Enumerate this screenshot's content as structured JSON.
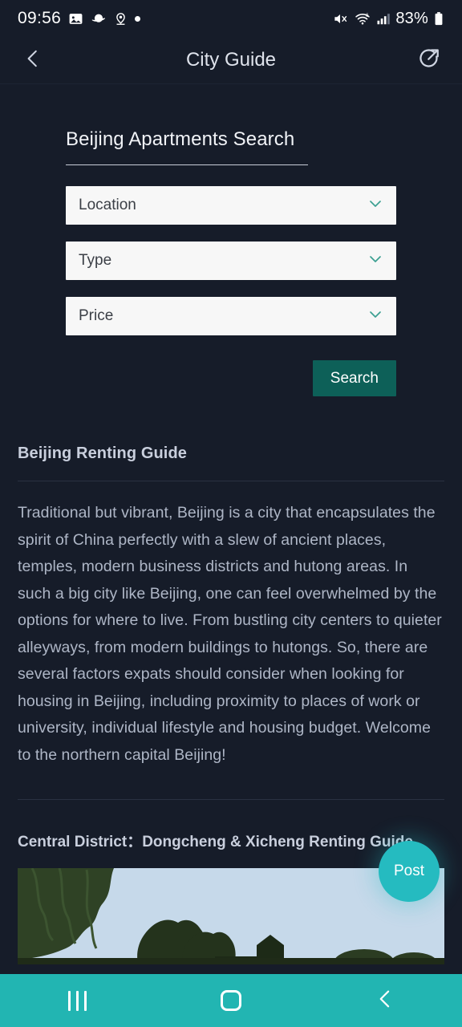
{
  "statusbar": {
    "time": "09:56",
    "battery_text": "83%",
    "left_icons": [
      "image-icon",
      "planet-icon",
      "location-pin-icon",
      "dot-icon"
    ],
    "right_icons": [
      "mute-icon",
      "wifi-6-icon",
      "cellular-signal-icon",
      "battery-icon"
    ]
  },
  "header": {
    "title": "City Guide",
    "back_icon": "chevron-left-icon",
    "share_icon": "share-icon"
  },
  "search_card": {
    "title": "Beijing Apartments Search",
    "fields": [
      {
        "label": "Location",
        "name": "location"
      },
      {
        "label": "Type",
        "name": "type"
      },
      {
        "label": "Price",
        "name": "price"
      }
    ],
    "submit_label": "Search",
    "chevron_icon": "chevron-down-icon"
  },
  "guide": {
    "heading": "Beijing Renting Guide",
    "body": "Traditional but vibrant, Beijing is a city that encapsulates the spirit of China perfectly with a slew of ancient places, temples, modern business districts and hutong areas. In such a big city like Beijing, one can feel overwhelmed by the options for where to live. From bustling city centers to quieter alleyways, from modern buildings to hutongs. So, there are several factors expats should consider when looking for housing in Beijing, including proximity to places of work or university, individual lifestyle and housing budget. Welcome to the northern capital Beijing!",
    "next_section_heading": "Central District：Dongcheng & Xicheng Renting Guide",
    "photo_alt": "willow-trees-photo"
  },
  "fab": {
    "label": "Post"
  },
  "navbar": {
    "recents_icon": "recents-icon",
    "home_icon": "home-icon",
    "back_icon": "nav-back-icon"
  },
  "colors": {
    "background": "#161c29",
    "accent_teal": "#22b5b2",
    "fab_teal": "#25bbc0",
    "button_green": "#0d6058",
    "field_bg": "#f7f7f7"
  }
}
